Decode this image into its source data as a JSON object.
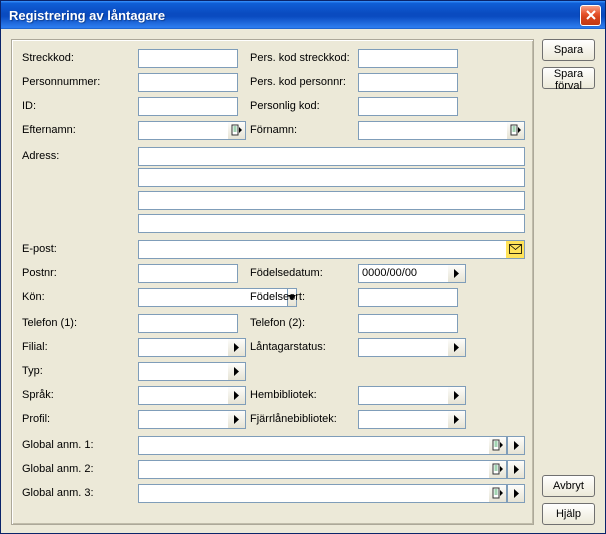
{
  "window": {
    "title": "Registrering av låntagare"
  },
  "buttons": {
    "save": "Spara",
    "save_default": "Spara förval",
    "cancel": "Avbryt",
    "help": "Hjälp"
  },
  "labels": {
    "streckkod": "Streckkod:",
    "pers_kod_streckkod": "Pers. kod streckkod:",
    "personnummer": "Personnummer:",
    "pers_kod_personnr": "Pers. kod personnr:",
    "id": "ID:",
    "personlig_kod": "Personlig kod:",
    "efternamn": "Efternamn:",
    "fornamn": "Förnamn:",
    "adress": "Adress:",
    "epost": "E-post:",
    "postnr": "Postnr:",
    "fodelsedatum": "Födelsedatum:",
    "kon": "Kön:",
    "fodelseort": "Födelseort:",
    "telefon1": "Telefon (1):",
    "telefon2": "Telefon (2):",
    "filial": "Filial:",
    "lantagarstatus": "Låntagarstatus:",
    "typ": "Typ:",
    "sprak": "Språk:",
    "hembibliotek": "Hembibliotek:",
    "profil": "Profil:",
    "fjarrlanebibliotek": "Fjärrlånebibliotek:",
    "global_anm_1": "Global anm. 1:",
    "global_anm_2": "Global anm. 2:",
    "global_anm_3": "Global anm. 3:"
  },
  "values": {
    "streckkod": "",
    "pers_kod_streckkod": "",
    "personnummer": "",
    "pers_kod_personnr": "",
    "id": "",
    "personlig_kod": "",
    "efternamn": "",
    "fornamn": "",
    "adress1": "",
    "adress2": "",
    "adress3": "",
    "adress4": "",
    "epost": "",
    "postnr": "",
    "fodelsedatum": "0000/00/00",
    "kon": "",
    "fodelseort": "",
    "telefon1": "",
    "telefon2": "",
    "filial": "",
    "lantagarstatus": "",
    "typ": "",
    "sprak": "",
    "hembibliotek": "",
    "profil": "",
    "fjarrlanebibliotek": "",
    "global1": "",
    "global2": "",
    "global3": ""
  }
}
